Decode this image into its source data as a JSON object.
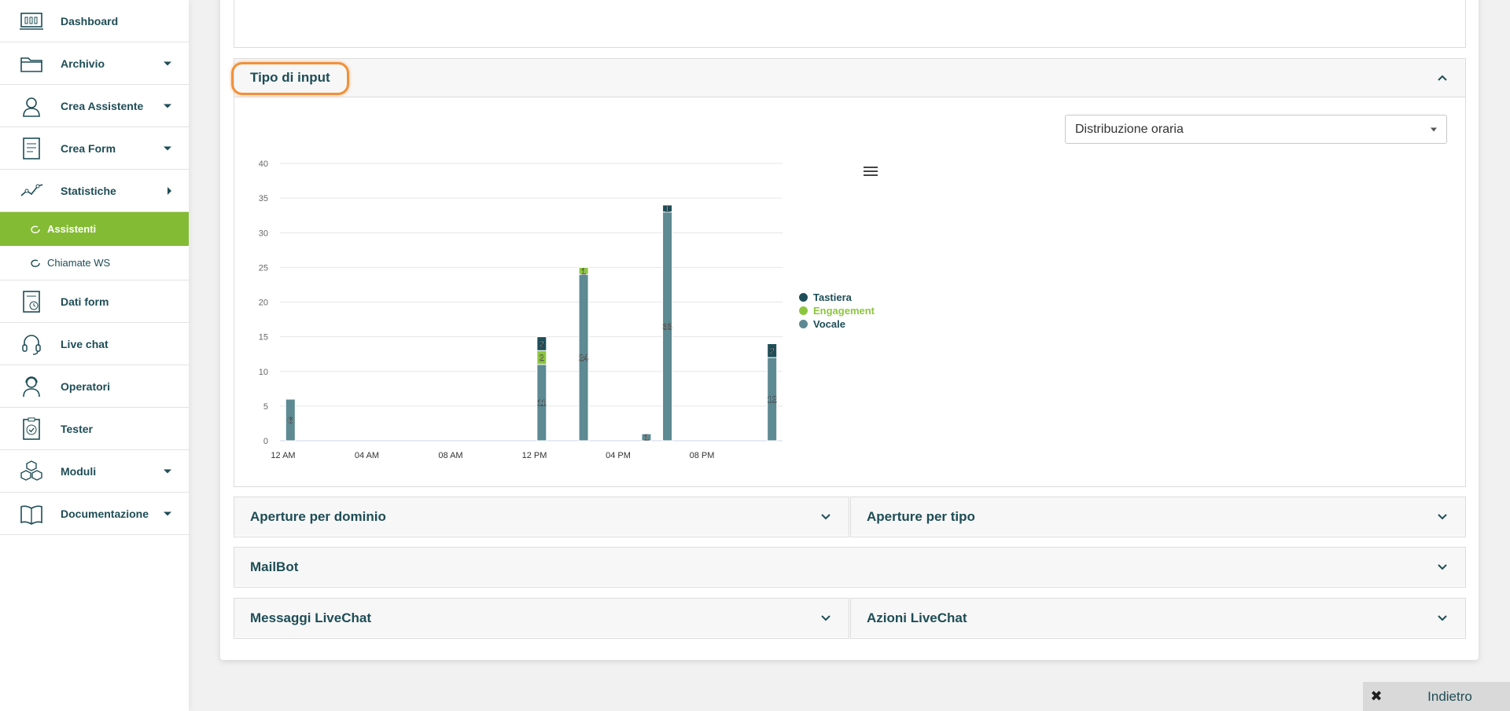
{
  "sidebar": {
    "items": [
      {
        "label": "Dashboard",
        "icon": "dashboard-icon",
        "caret": "none"
      },
      {
        "label": "Archivio",
        "icon": "folder-icon",
        "caret": "down"
      },
      {
        "label": "Crea Assistente",
        "icon": "assistant-icon",
        "caret": "down"
      },
      {
        "label": "Crea Form",
        "icon": "form-icon",
        "caret": "down"
      },
      {
        "label": "Statistiche",
        "icon": "stats-icon",
        "caret": "right"
      }
    ],
    "subitems": [
      {
        "label": "Assistenti",
        "active": true
      },
      {
        "label": "Chiamate WS",
        "active": false
      }
    ],
    "items2": [
      {
        "label": "Dati form",
        "icon": "form-data-icon",
        "caret": "none"
      },
      {
        "label": "Live chat",
        "icon": "headset-icon",
        "caret": "none"
      },
      {
        "label": "Operatori",
        "icon": "operator-icon",
        "caret": "none"
      },
      {
        "label": "Tester",
        "icon": "tester-icon",
        "caret": "none"
      },
      {
        "label": "Moduli",
        "icon": "modules-icon",
        "caret": "down"
      },
      {
        "label": "Documentazione",
        "icon": "book-icon",
        "caret": "down"
      }
    ]
  },
  "panels": {
    "tipo_input": {
      "title": "Tipo di input"
    },
    "aperture_dominio": {
      "title": "Aperture per dominio"
    },
    "aperture_tipo": {
      "title": "Aperture per tipo"
    },
    "mailbot": {
      "title": "MailBot"
    },
    "messaggi_livechat": {
      "title": "Messaggi LiveChat"
    },
    "azioni_livechat": {
      "title": "Azioni LiveChat"
    }
  },
  "select": {
    "value": "Distribuzione oraria"
  },
  "footer": {
    "back_label": "Indietro",
    "close_glyph": "✖"
  },
  "colors": {
    "accent": "#84bb34",
    "tastiera": "#1d4f59",
    "engagement": "#8cc63e",
    "vocale": "#5d8a93",
    "text": "#1e4d56"
  },
  "chart_data": {
    "type": "bar",
    "stacked": true,
    "x_ticks": [
      "12 AM",
      "04 AM",
      "08 AM",
      "12 PM",
      "04 PM",
      "08 PM"
    ],
    "hours": [
      0,
      12,
      14,
      17,
      18,
      23
    ],
    "ylim": [
      0,
      40
    ],
    "y_ticks": [
      0,
      5,
      10,
      15,
      20,
      25,
      30,
      35,
      40
    ],
    "legend_position": "right",
    "series": [
      {
        "name": "Tastiera",
        "color": "#1d4f59",
        "values": [
          0,
          2,
          0,
          0,
          1,
          2
        ]
      },
      {
        "name": "Engagement",
        "color": "#8cc63e",
        "values": [
          0,
          2,
          1,
          0,
          0,
          0
        ]
      },
      {
        "name": "Vocale",
        "color": "#5d8a93",
        "values": [
          6,
          11,
          24,
          1,
          33,
          12
        ]
      }
    ]
  }
}
